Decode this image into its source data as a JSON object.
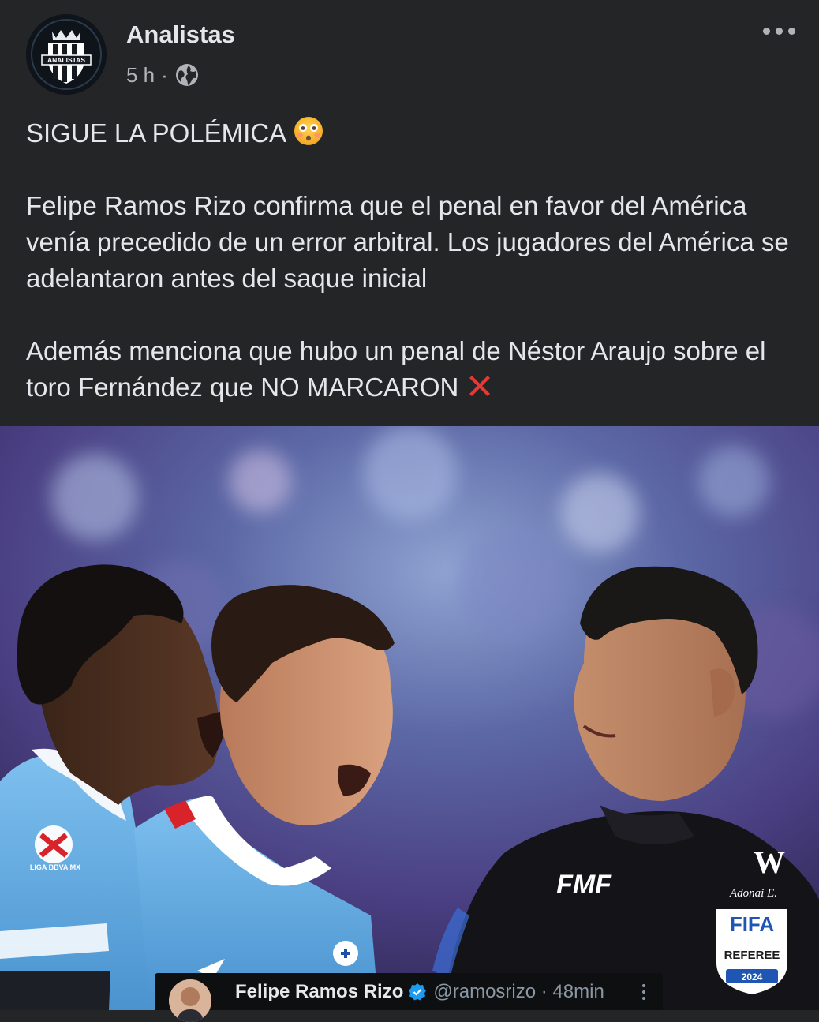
{
  "post": {
    "page_name": "Analistas",
    "time": "5 h",
    "separator": "·",
    "logo_text": "ANALISTAS",
    "privacy_icon": "globe-icon",
    "more_icon": "more-horizontal-icon",
    "headline": "SIGUE LA POLÉMICA",
    "headline_emoji": "flushed-face-emoji",
    "paragraph_1": "Felipe Ramos Rizo confirma que el penal en favor del América venía precedido de un error arbitral. Los jugadores del América se adelantaron antes del saque inicial",
    "paragraph_2": "Además menciona que hubo un penal de Néstor Araujo sobre el toro Fernández que NO MARCARON",
    "paragraph_2_emoji": "red-cross-mark-emoji"
  },
  "photo": {
    "jersey_text_fmf": "FMF",
    "jersey_text_w": "W",
    "jersey_signature": "Adonai E.",
    "badge_fifa": "FIFA",
    "badge_referee": "REFEREE",
    "badge_year": "2024",
    "liga_patch": "LIGA BBVA MX"
  },
  "tweet": {
    "name": "Felipe Ramos Rizo",
    "handle_time": "@ramosrizo · 48min",
    "verified_icon": "verified-badge-icon",
    "menu_icon": "more-vertical-icon"
  },
  "colors": {
    "background": "#242526",
    "text": "#e4e6eb",
    "secondary_text": "#b0b3b8",
    "jersey_blue": "#5fa9e0",
    "referee_black": "#141418"
  }
}
